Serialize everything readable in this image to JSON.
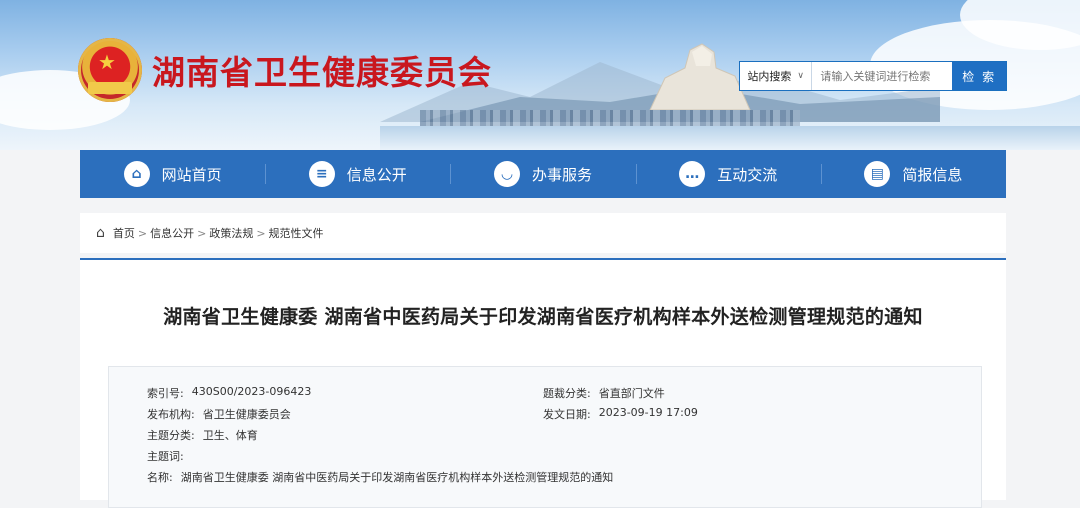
{
  "site": {
    "title": "湖南省卫生健康委员会"
  },
  "search": {
    "scope": "站内搜索",
    "placeholder": "请输入关键词进行检索",
    "button": "检 索"
  },
  "nav": [
    {
      "label": "网站首页",
      "icon": "home-icon"
    },
    {
      "label": "信息公开",
      "icon": "list-icon"
    },
    {
      "label": "办事服务",
      "icon": "service-icon"
    },
    {
      "label": "互动交流",
      "icon": "chat-icon"
    },
    {
      "label": "简报信息",
      "icon": "doc-icon"
    }
  ],
  "breadcrumb": [
    "首页",
    "信息公开",
    "政策法规",
    "规范性文件"
  ],
  "article": {
    "title": "湖南省卫生健康委 湖南省中医药局关于印发湖南省医疗机构样本外送检测管理规范的通知"
  },
  "meta": {
    "index_label": "索引号:",
    "index_value": "430S00/2023-096423",
    "category_label": "题裁分类:",
    "category_value": "省直部门文件",
    "publisher_label": "发布机构:",
    "publisher_value": "省卫生健康委员会",
    "date_label": "发文日期:",
    "date_value": "2023-09-19 17:09",
    "topic_label": "主题分类:",
    "topic_value": "卫生、体育",
    "keyword_label": "主题词:",
    "keyword_value": "",
    "name_label": "名称:",
    "name_value": "湖南省卫生健康委 湖南省中医药局关于印发湖南省医疗机构样本外送检测管理规范的通知"
  },
  "colors": {
    "brand_red": "#c9171e",
    "nav_blue": "#2c6fbd"
  }
}
